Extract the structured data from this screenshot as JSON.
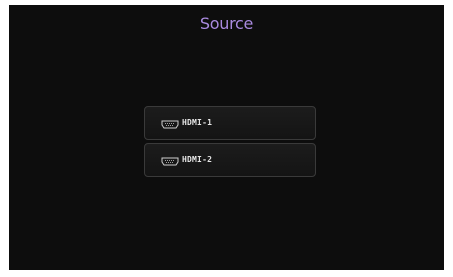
{
  "screen": {
    "title": "Source",
    "title_color": "#a98adf",
    "background": "#0d0d0d"
  },
  "sources": [
    {
      "label": "HDMI-1",
      "icon": "hdmi-port-icon"
    },
    {
      "label": "HDMI-2",
      "icon": "hdmi-port-icon"
    }
  ]
}
